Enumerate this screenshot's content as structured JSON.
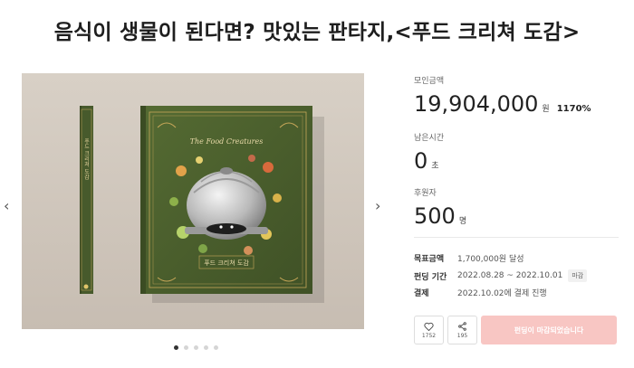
{
  "page": {
    "title": "음식이 생물이 된다면? 맛있는 판타지,<푸드 크리쳐 도감>"
  },
  "gallery": {
    "cover_title": "The Food Creatures",
    "cover_subtitle": "푸드 크리쳐 도감",
    "spine_text": "푸드 크리쳐 도감",
    "slide_count": 5,
    "active_slide": 1,
    "prev_label": "‹",
    "next_label": "›"
  },
  "funding": {
    "raised_label": "모인금액",
    "raised_amount": "19,904,000",
    "raised_unit": "원",
    "raised_percent": "1170%",
    "time_label": "남은시간",
    "time_value": "0",
    "time_unit": "초",
    "backers_label": "후원자",
    "backers_value": "500",
    "backers_unit": "명"
  },
  "details": {
    "goal_key": "목표금액",
    "goal_value": "1,700,000원 달성",
    "period_key": "펀딩 기간",
    "period_value": "2022.08.28 ~ 2022.10.01",
    "period_badge": "마감",
    "payment_key": "결제",
    "payment_value": "2022.10.02에 결제 진행"
  },
  "actions": {
    "like_count": "1752",
    "share_count": "195",
    "cta_label": "펀딩이 마감되었습니다"
  },
  "colors": {
    "cta_bg": "#f8c6c3",
    "book_green": "#4b5d2e",
    "gold": "#c9a85a"
  }
}
